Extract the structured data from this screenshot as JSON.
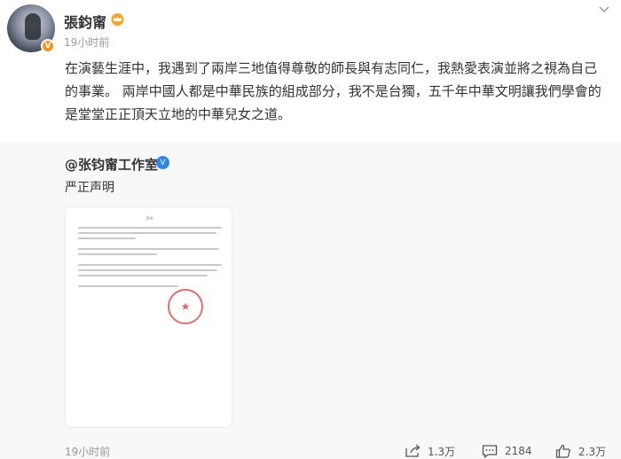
{
  "post": {
    "username": "張鈞甯",
    "time": "19小时前",
    "text": "在演藝生涯中，我遇到了兩岸三地值得尊敬的師長與有志同仁，我熱愛表演並將之視為自己的事業。 兩岸中國人都是中華民族的組成部分，我不是台獨，五千年中華文明讓我們學會的是堂堂正正頂天立地的中華兒女之道。",
    "verified_badge": "V",
    "badge_color": "#f7931a"
  },
  "repost": {
    "author": "@张钧甯工作室",
    "verified_badge": "V",
    "badge_color": "#2d86e8",
    "text": "严正声明",
    "document": {
      "title": "声明"
    }
  },
  "footer": {
    "time": "19小时前",
    "share_count": "1.3万",
    "comment_count": "2184",
    "like_count": "2.3万"
  },
  "icons": {
    "crown": "crown-icon",
    "chevron": "chevron-down-icon",
    "share": "share-icon",
    "comment": "comment-icon",
    "like": "like-icon"
  }
}
